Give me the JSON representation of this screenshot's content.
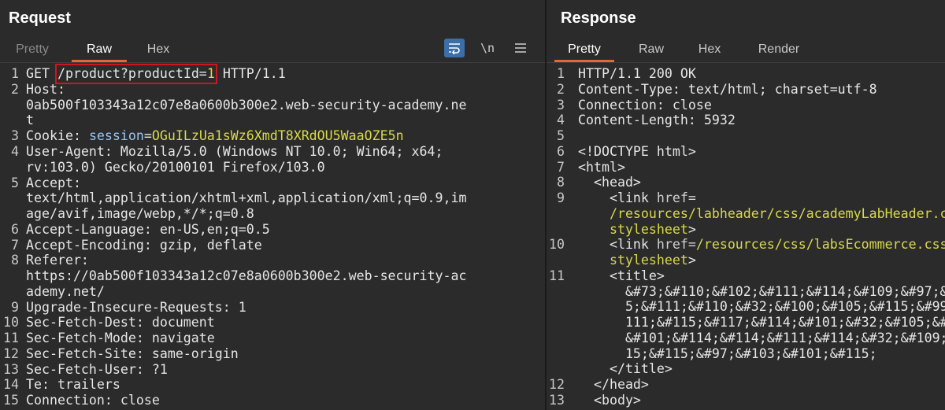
{
  "request": {
    "title": "Request",
    "tabs": [
      {
        "label": "Pretty"
      },
      {
        "label": "Raw"
      },
      {
        "label": "Hex"
      }
    ],
    "toolbar": {
      "newline_label": "\\n"
    },
    "method": "GET",
    "path_prefix": "/product?productId=",
    "path_value": "1",
    "protocol": "HTTP/1.1",
    "line_numbers": [
      "1",
      "2",
      "3",
      "4",
      "5",
      "6",
      "7",
      "8",
      "9",
      "10",
      "11",
      "12",
      "13",
      "14",
      "15"
    ],
    "headers": {
      "host_name": "Host:",
      "host_value_1": "0ab500f103343a12c07e8a0600b300e2.web-security-academy.ne",
      "host_value_2": "t",
      "cookie_name": "Cookie:",
      "cookie_key": "session",
      "cookie_eq": "=",
      "cookie_value": "OGuILzUa1sWz6XmdT8XRdOU5WaaOZE5n",
      "ua_1": "User-Agent: Mozilla/5.0 (Windows NT 10.0; Win64; x64;",
      "ua_2": "rv:103.0) Gecko/20100101 Firefox/103.0",
      "accept_name": "Accept:",
      "accept_1": "text/html,application/xhtml+xml,application/xml;q=0.9,im",
      "accept_2": "age/avif,image/webp,*/*;q=0.8",
      "accept_lang": "Accept-Language: en-US,en;q=0.5",
      "accept_enc": "Accept-Encoding: gzip, deflate",
      "referer_name": "Referer:",
      "referer_1": "https://0ab500f103343a12c07e8a0600b300e2.web-security-ac",
      "referer_2": "ademy.net/",
      "upgrade": "Upgrade-Insecure-Requests: 1",
      "sfd": "Sec-Fetch-Dest: document",
      "sfm": "Sec-Fetch-Mode: navigate",
      "sfs": "Sec-Fetch-Site: same-origin",
      "sfu": "Sec-Fetch-User: ?1",
      "te": "Te: trailers",
      "conn": "Connection: close"
    }
  },
  "response": {
    "title": "Response",
    "tabs": [
      {
        "label": "Pretty"
      },
      {
        "label": "Raw"
      },
      {
        "label": "Hex"
      },
      {
        "label": "Render"
      }
    ],
    "line_numbers": [
      "1",
      "2",
      "3",
      "4",
      "5",
      "6",
      "7",
      "8",
      "9",
      "",
      "10",
      "",
      "11",
      "",
      "",
      "",
      "",
      "",
      "12",
      "13"
    ],
    "lines": {
      "l1": "HTTP/1.1 200 OK",
      "l2": "Content-Type: text/html; charset=utf-8",
      "l3": "Connection: close",
      "l4": "Content-Length: 5932",
      "l6": "<!DOCTYPE html>",
      "l7": "<html>",
      "l8": "  <head>",
      "l9a_tag": "    <link ",
      "l9a_attr": "href=",
      "l9b": "    /resources/labheader/css/academyLabHeader.css rel=",
      "l9c_val": "    stylesheet",
      "l9c_end": ">",
      "l10a_tag": "    <link ",
      "l10a_attr": "href=",
      "l10a_val": "/resources/css/labsEcommerce.css rel=",
      "l10b_val": "    stylesheet",
      "l10b_end": ">",
      "l11": "    <title>",
      "l11a": "      &#73;&#110;&#102;&#111;&#114;&#109;&#97;&#116;&#10",
      "l11b": "      5;&#111;&#110;&#32;&#100;&#105;&#115;&#99;&#108;&#",
      "l11c": "      111;&#115;&#117;&#114;&#101;&#32;&#105;&#110;&#32;",
      "l11d": "      &#101;&#114;&#114;&#111;&#114;&#32;&#109;&#101;&#1",
      "l11e": "      15;&#115;&#97;&#103;&#101;&#115;",
      "l11f": "    </title>",
      "l12": "  </head>",
      "l13": "  <body>"
    }
  }
}
